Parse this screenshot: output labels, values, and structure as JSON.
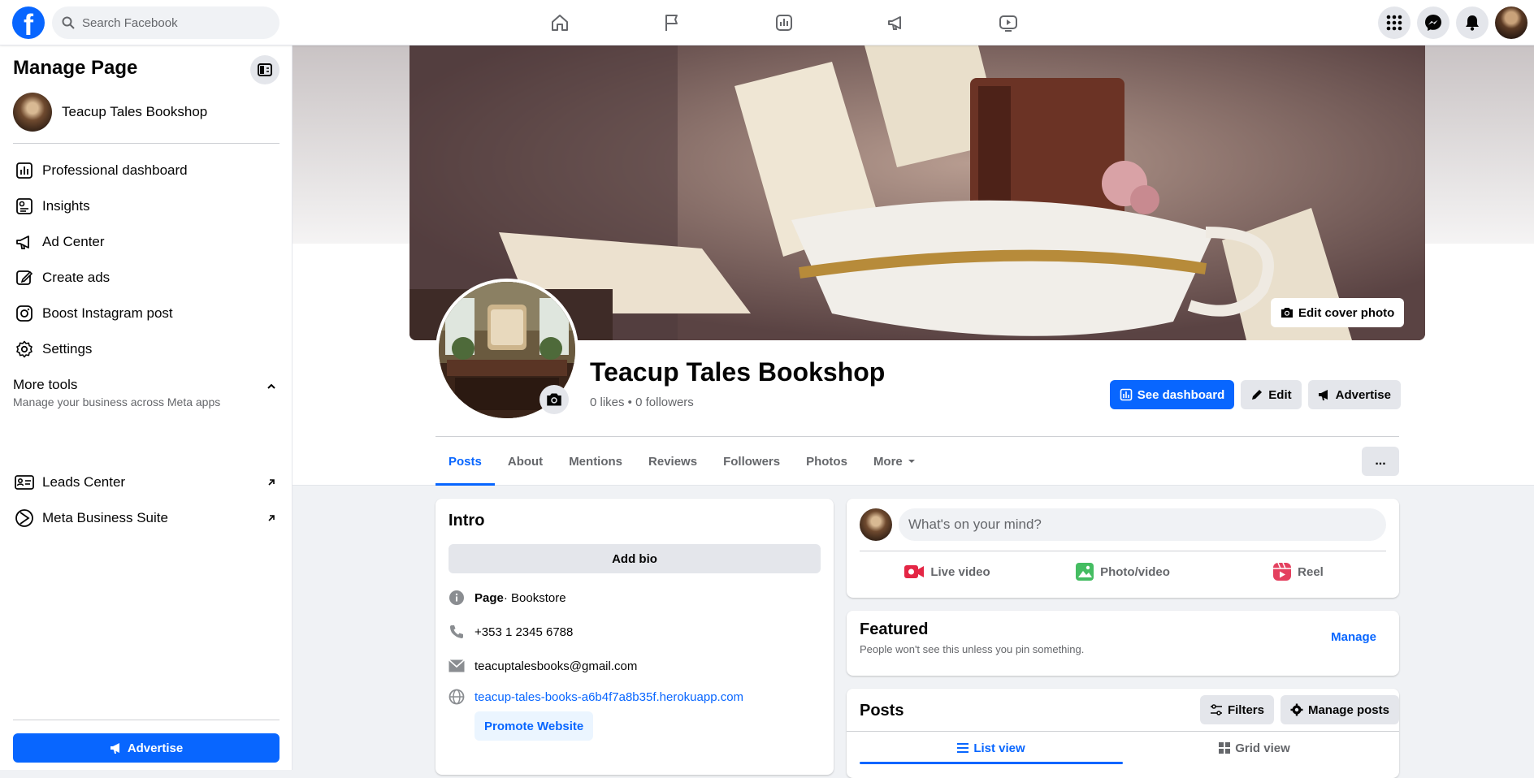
{
  "topbar": {
    "logo": "f",
    "search_placeholder": "Search Facebook",
    "nav_icons": [
      "home-icon",
      "flag-icon",
      "insights-icon",
      "megaphone-icon",
      "video-icon"
    ],
    "right_icons": [
      "menu-grid-icon",
      "messenger-icon",
      "notifications-icon",
      "profile-avatar"
    ]
  },
  "sidebar": {
    "title": "Manage Page",
    "page_name": "Teacup Tales Bookshop",
    "items": [
      {
        "label": "Professional dashboard",
        "icon": "dashboard-icon"
      },
      {
        "label": "Insights",
        "icon": "insights-icon"
      },
      {
        "label": "Ad Center",
        "icon": "megaphone-icon"
      },
      {
        "label": "Create ads",
        "icon": "pencil-icon"
      },
      {
        "label": "Boost Instagram post",
        "icon": "instagram-icon"
      },
      {
        "label": "Settings",
        "icon": "gear-icon"
      }
    ],
    "more_tools": {
      "title": "More tools",
      "subtitle": "Manage your business across Meta apps"
    },
    "tool_items": [
      {
        "label": "Leads Center",
        "icon": "leads-icon"
      },
      {
        "label": "Meta Business Suite",
        "icon": "business-suite-icon"
      }
    ],
    "advertise_label": "Advertise"
  },
  "header": {
    "edit_cover_label": "Edit cover photo",
    "page_name": "Teacup Tales Bookshop",
    "stats": "0 likes • 0 followers",
    "buttons": {
      "dashboard": "See dashboard",
      "edit": "Edit",
      "advertise": "Advertise"
    },
    "tabs": [
      "Posts",
      "About",
      "Mentions",
      "Reviews",
      "Followers",
      "Photos",
      "More"
    ],
    "more_menu": "..."
  },
  "intro": {
    "title": "Intro",
    "add_bio": "Add bio",
    "category_label": "Page",
    "category": " · Bookstore",
    "phone": "+353 1 2345 6788",
    "email": "teacuptalesbooks@gmail.com",
    "website": "teacup-tales-books-a6b4f7a8b35f.herokuapp.com",
    "promote": "Promote Website"
  },
  "composer": {
    "placeholder": "What's on your mind?",
    "actions": [
      "Live video",
      "Photo/video",
      "Reel"
    ]
  },
  "featured": {
    "title": "Featured",
    "subtitle": "People won't see this unless you pin something.",
    "manage": "Manage"
  },
  "posts": {
    "title": "Posts",
    "filters": "Filters",
    "manage": "Manage posts",
    "views": [
      "List view",
      "Grid view"
    ]
  },
  "colors": {
    "accent": "#0866ff",
    "live": "#e42645",
    "photo": "#45bd62",
    "reel": "#e4405f"
  }
}
